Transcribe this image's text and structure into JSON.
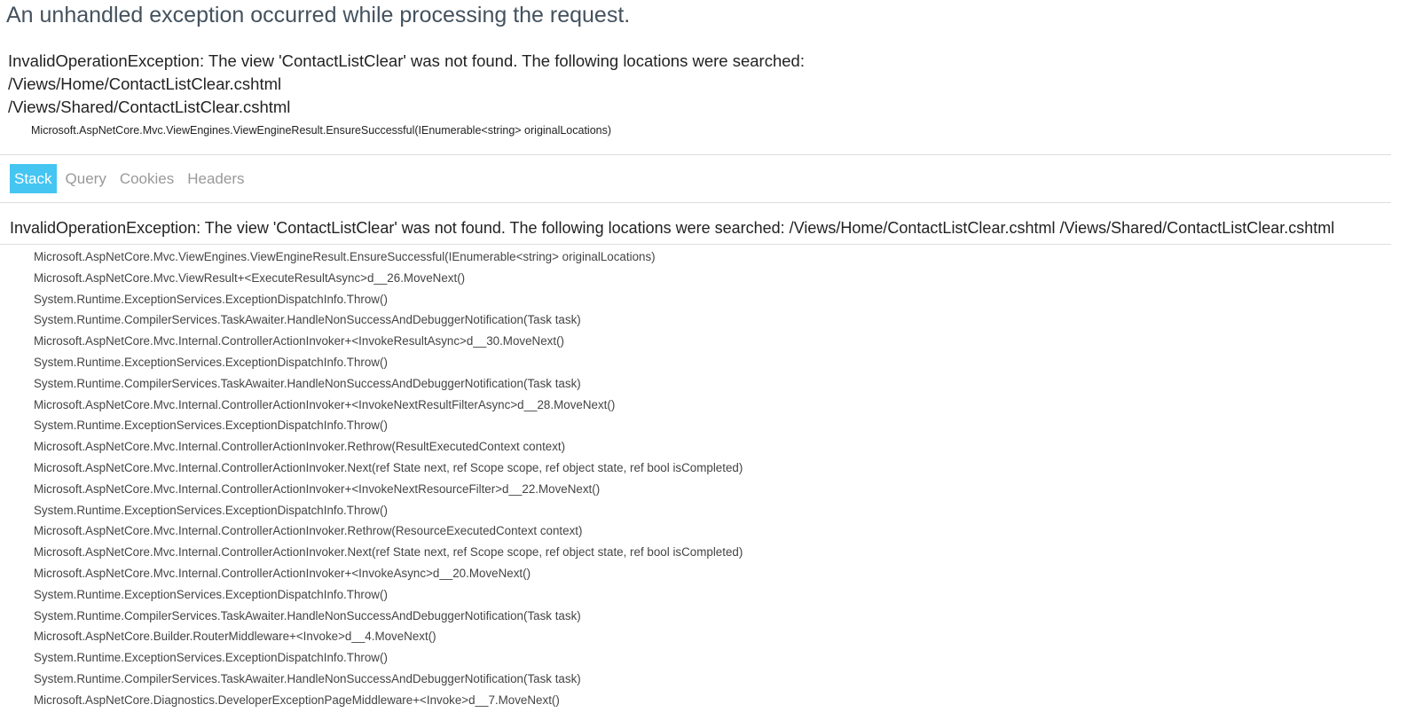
{
  "page": {
    "title": "An unhandled exception occurred while processing the request."
  },
  "summary": {
    "message": "InvalidOperationException: The view 'ContactListClear' was not found. The following locations were searched:",
    "locations": [
      "/Views/Home/ContactListClear.cshtml",
      "/Views/Shared/ContactListClear.cshtml"
    ],
    "location": "Microsoft.AspNetCore.Mvc.ViewEngines.ViewEngineResult.EnsureSuccessful(IEnumerable<string> originalLocations)"
  },
  "tabs": [
    {
      "label": "Stack",
      "active": true
    },
    {
      "label": "Query",
      "active": false
    },
    {
      "label": "Cookies",
      "active": false
    },
    {
      "label": "Headers",
      "active": false
    }
  ],
  "stack": {
    "heading": "InvalidOperationException: The view 'ContactListClear' was not found. The following locations were searched: /Views/Home/ContactListClear.cshtml /Views/Shared/ContactListClear.cshtml",
    "frames": [
      "Microsoft.AspNetCore.Mvc.ViewEngines.ViewEngineResult.EnsureSuccessful(IEnumerable<string> originalLocations)",
      "Microsoft.AspNetCore.Mvc.ViewResult+<ExecuteResultAsync>d__26.MoveNext()",
      "System.Runtime.ExceptionServices.ExceptionDispatchInfo.Throw()",
      "System.Runtime.CompilerServices.TaskAwaiter.HandleNonSuccessAndDebuggerNotification(Task task)",
      "Microsoft.AspNetCore.Mvc.Internal.ControllerActionInvoker+<InvokeResultAsync>d__30.MoveNext()",
      "System.Runtime.ExceptionServices.ExceptionDispatchInfo.Throw()",
      "System.Runtime.CompilerServices.TaskAwaiter.HandleNonSuccessAndDebuggerNotification(Task task)",
      "Microsoft.AspNetCore.Mvc.Internal.ControllerActionInvoker+<InvokeNextResultFilterAsync>d__28.MoveNext()",
      "System.Runtime.ExceptionServices.ExceptionDispatchInfo.Throw()",
      "Microsoft.AspNetCore.Mvc.Internal.ControllerActionInvoker.Rethrow(ResultExecutedContext context)",
      "Microsoft.AspNetCore.Mvc.Internal.ControllerActionInvoker.Next(ref State next, ref Scope scope, ref object state, ref bool isCompleted)",
      "Microsoft.AspNetCore.Mvc.Internal.ControllerActionInvoker+<InvokeNextResourceFilter>d__22.MoveNext()",
      "System.Runtime.ExceptionServices.ExceptionDispatchInfo.Throw()",
      "Microsoft.AspNetCore.Mvc.Internal.ControllerActionInvoker.Rethrow(ResourceExecutedContext context)",
      "Microsoft.AspNetCore.Mvc.Internal.ControllerActionInvoker.Next(ref State next, ref Scope scope, ref object state, ref bool isCompleted)",
      "Microsoft.AspNetCore.Mvc.Internal.ControllerActionInvoker+<InvokeAsync>d__20.MoveNext()",
      "System.Runtime.ExceptionServices.ExceptionDispatchInfo.Throw()",
      "System.Runtime.CompilerServices.TaskAwaiter.HandleNonSuccessAndDebuggerNotification(Task task)",
      "Microsoft.AspNetCore.Builder.RouterMiddleware+<Invoke>d__4.MoveNext()",
      "System.Runtime.ExceptionServices.ExceptionDispatchInfo.Throw()",
      "System.Runtime.CompilerServices.TaskAwaiter.HandleNonSuccessAndDebuggerNotification(Task task)",
      "Microsoft.AspNetCore.Diagnostics.DeveloperExceptionPageMiddleware+<Invoke>d__7.MoveNext()"
    ]
  },
  "colors": {
    "active_tab_background": "#44c5f2",
    "inactive_tab_text": "#999999",
    "title_text": "#44525e",
    "divider": "#dddddd"
  }
}
